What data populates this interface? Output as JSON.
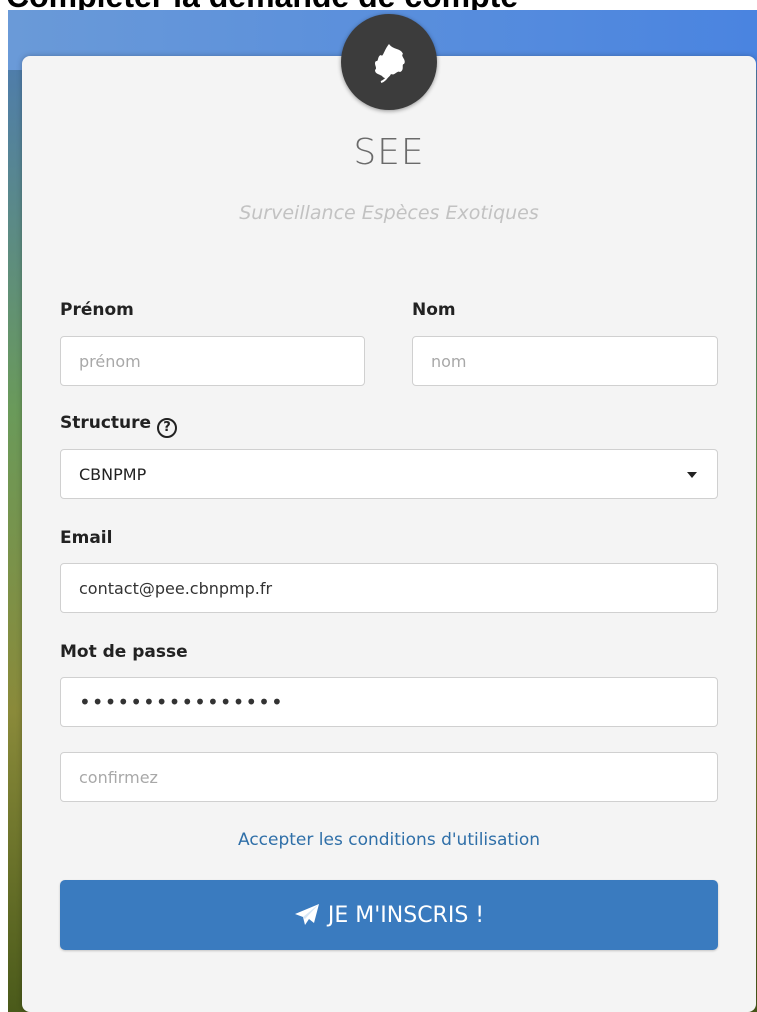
{
  "page_heading": "Compléter la demande de compte",
  "app": {
    "title": "SEE",
    "subtitle": "Surveillance Espèces Exotiques",
    "logo_icon": "leaf-icon"
  },
  "form": {
    "firstname": {
      "label": "Prénom",
      "placeholder": "prénom",
      "value": ""
    },
    "lastname": {
      "label": "Nom",
      "placeholder": "nom",
      "value": ""
    },
    "structure": {
      "label": "Structure",
      "help_icon": "question-circle-icon",
      "help_glyph": "?",
      "selected": "CBNPMP"
    },
    "email": {
      "label": "Email",
      "value": "contact@pee.cbnpmp.fr"
    },
    "password": {
      "label": "Mot de passe",
      "value": "••••••••••••••••"
    },
    "confirm": {
      "placeholder": "confirmez",
      "value": ""
    },
    "terms_link": "Accepter les conditions d'utilisation",
    "submit": {
      "label": "JE M'INSCRIS !",
      "icon": "paper-plane-icon"
    }
  },
  "colors": {
    "accent": "#3a7bbf",
    "link": "#2f6fa8",
    "card": "#f4f4f4",
    "logo_bg": "#3c3c3c"
  }
}
